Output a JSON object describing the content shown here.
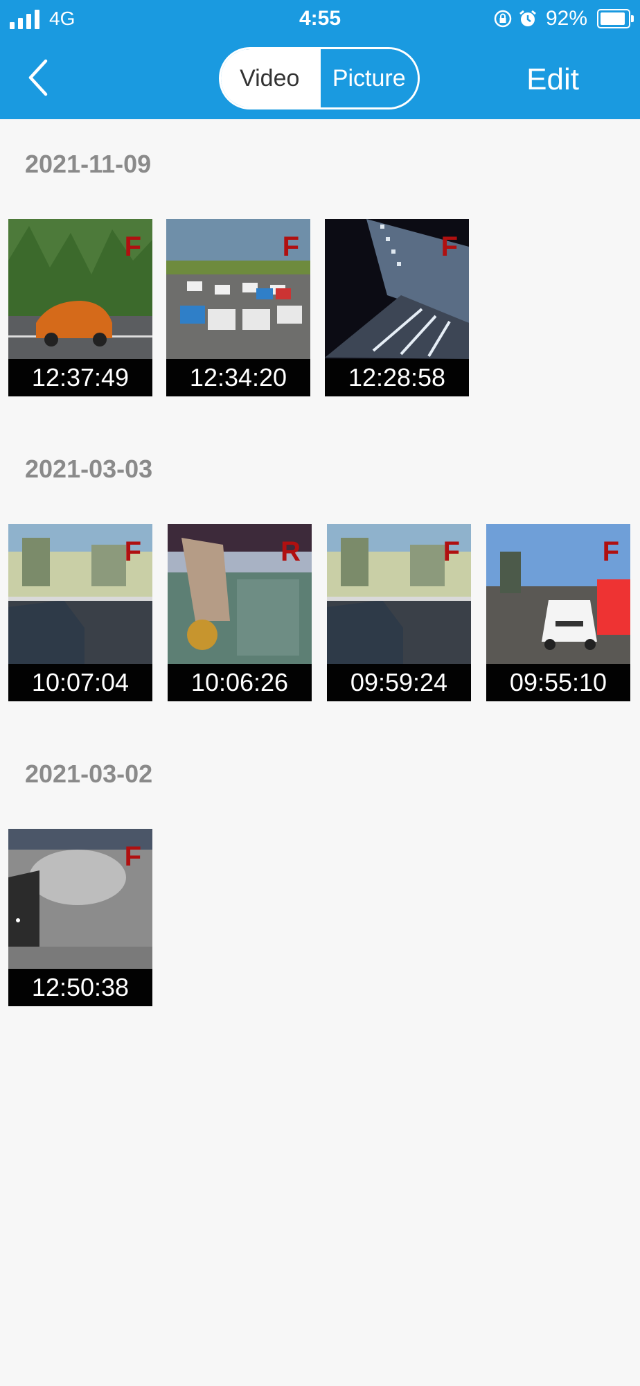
{
  "status_bar": {
    "network": "4G",
    "time": "4:55",
    "battery_percent": "92%",
    "battery_level": 0.92
  },
  "nav": {
    "tabs": [
      {
        "label": "Video",
        "active": true
      },
      {
        "label": "Picture",
        "active": false
      }
    ],
    "edit_label": "Edit"
  },
  "colors": {
    "accent": "#1a9ae0",
    "camera_marker": "#b01010"
  },
  "groups": [
    {
      "date": "2021-11-09",
      "items": [
        {
          "time": "12:37:49",
          "camera": "F"
        },
        {
          "time": "12:34:20",
          "camera": "F"
        },
        {
          "time": "12:28:58",
          "camera": "F"
        }
      ]
    },
    {
      "date": "2021-03-03",
      "items": [
        {
          "time": "10:07:04",
          "camera": "F"
        },
        {
          "time": "10:06:26",
          "camera": "R"
        },
        {
          "time": "09:59:24",
          "camera": "F"
        },
        {
          "time": "09:55:10",
          "camera": "F"
        }
      ]
    },
    {
      "date": "2021-03-02",
      "items": [
        {
          "time": "12:50:38",
          "camera": "F"
        }
      ]
    }
  ]
}
